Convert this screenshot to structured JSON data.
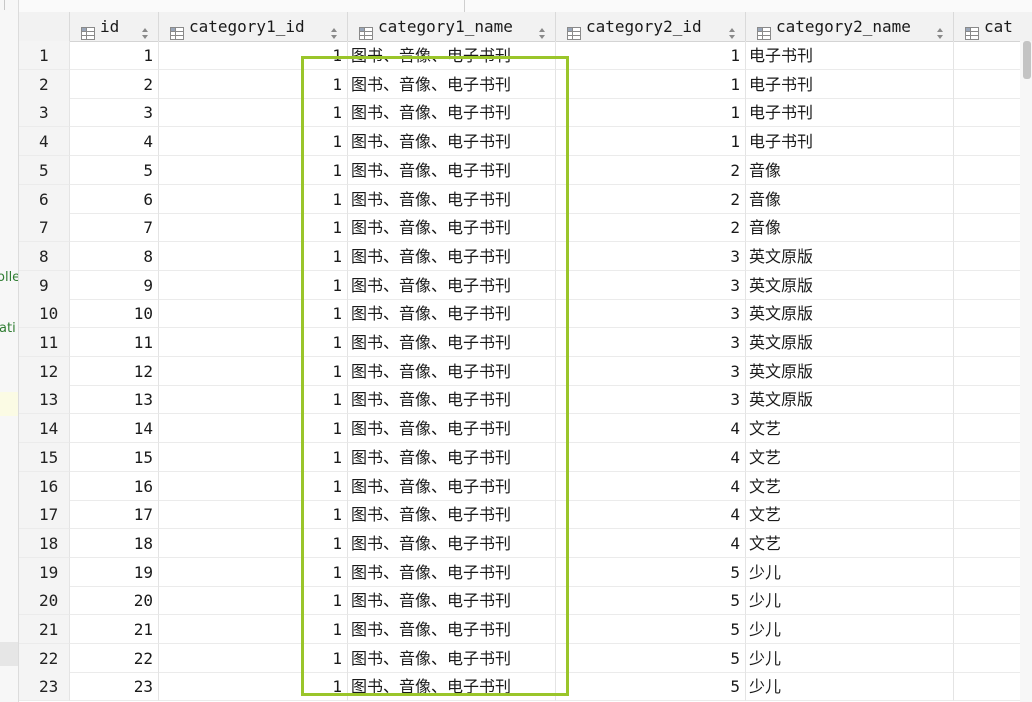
{
  "columns": [
    {
      "label": "id",
      "type": "num"
    },
    {
      "label": "category1_id",
      "type": "num"
    },
    {
      "label": "category1_name",
      "type": "txt"
    },
    {
      "label": "category2_id",
      "type": "num"
    },
    {
      "label": "category2_name",
      "type": "txt"
    },
    {
      "label": "cat",
      "type": "txt"
    }
  ],
  "rows": [
    [
      "1",
      "1",
      "1",
      "图书、音像、电子书刊",
      "1",
      "电子书刊"
    ],
    [
      "2",
      "2",
      "1",
      "图书、音像、电子书刊",
      "1",
      "电子书刊"
    ],
    [
      "3",
      "3",
      "1",
      "图书、音像、电子书刊",
      "1",
      "电子书刊"
    ],
    [
      "4",
      "4",
      "1",
      "图书、音像、电子书刊",
      "1",
      "电子书刊"
    ],
    [
      "5",
      "5",
      "1",
      "图书、音像、电子书刊",
      "2",
      "音像"
    ],
    [
      "6",
      "6",
      "1",
      "图书、音像、电子书刊",
      "2",
      "音像"
    ],
    [
      "7",
      "7",
      "1",
      "图书、音像、电子书刊",
      "2",
      "音像"
    ],
    [
      "8",
      "8",
      "1",
      "图书、音像、电子书刊",
      "3",
      "英文原版"
    ],
    [
      "9",
      "9",
      "1",
      "图书、音像、电子书刊",
      "3",
      "英文原版"
    ],
    [
      "10",
      "10",
      "1",
      "图书、音像、电子书刊",
      "3",
      "英文原版"
    ],
    [
      "11",
      "11",
      "1",
      "图书、音像、电子书刊",
      "3",
      "英文原版"
    ],
    [
      "12",
      "12",
      "1",
      "图书、音像、电子书刊",
      "3",
      "英文原版"
    ],
    [
      "13",
      "13",
      "1",
      "图书、音像、电子书刊",
      "3",
      "英文原版"
    ],
    [
      "14",
      "14",
      "1",
      "图书、音像、电子书刊",
      "4",
      "文艺"
    ],
    [
      "15",
      "15",
      "1",
      "图书、音像、电子书刊",
      "4",
      "文艺"
    ],
    [
      "16",
      "16",
      "1",
      "图书、音像、电子书刊",
      "4",
      "文艺"
    ],
    [
      "17",
      "17",
      "1",
      "图书、音像、电子书刊",
      "4",
      "文艺"
    ],
    [
      "18",
      "18",
      "1",
      "图书、音像、电子书刊",
      "4",
      "文艺"
    ],
    [
      "19",
      "19",
      "1",
      "图书、音像、电子书刊",
      "5",
      "少儿"
    ],
    [
      "20",
      "20",
      "1",
      "图书、音像、电子书刊",
      "5",
      "少儿"
    ],
    [
      "21",
      "21",
      "1",
      "图书、音像、电子书刊",
      "5",
      "少儿"
    ],
    [
      "22",
      "22",
      "1",
      "图书、音像、电子书刊",
      "5",
      "少儿"
    ],
    [
      "23",
      "23",
      "1",
      "图书、音像、电子书刊",
      "5",
      "少儿"
    ]
  ],
  "left_strip": {
    "fragment_1": "olle",
    "fragment_2": "ati"
  },
  "icons": {
    "column": "table-column-icon",
    "sort": "sort-arrows-icon"
  },
  "colors": {
    "annotation_box": "#9ac52a",
    "header_bg": "#f2f2f2",
    "rownum_bg": "#f4f4f4",
    "gutter_text": "#2f7d32"
  }
}
